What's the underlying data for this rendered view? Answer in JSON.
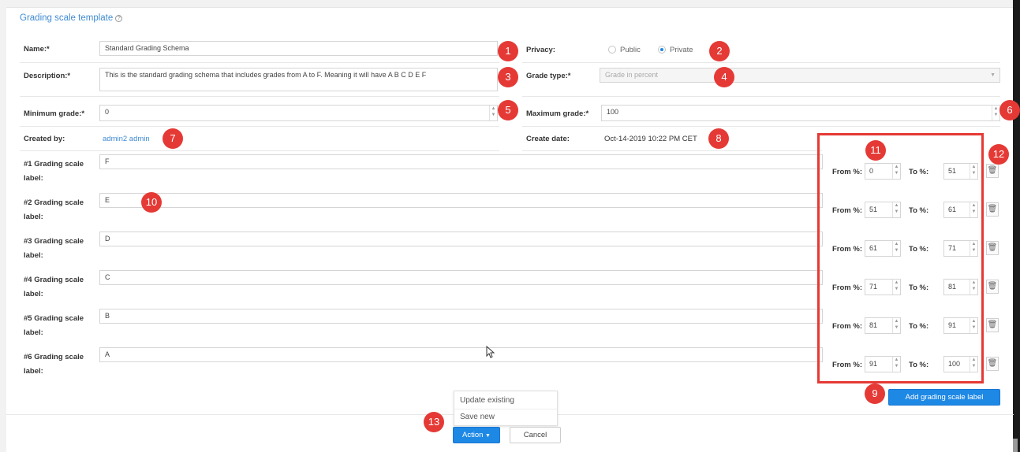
{
  "title": "Grading scale template",
  "help_icon": "question-circle-icon",
  "name": {
    "label": "Name:*",
    "value": "Standard Grading Schema"
  },
  "privacy": {
    "label": "Privacy:",
    "options": [
      "Public",
      "Private"
    ],
    "selected": "Private"
  },
  "description": {
    "label": "Description:*",
    "value": "This is the standard grading schema that includes grades from A to F. Meaning it will have A B C D E F"
  },
  "grade_type": {
    "label": "Grade type:*",
    "value": "Grade in percent"
  },
  "min_grade": {
    "label": "Minimum grade:*",
    "value": "0"
  },
  "max_grade": {
    "label": "Maximum grade:*",
    "value": "100"
  },
  "created_by": {
    "label": "Created by:",
    "value": "admin2 admin"
  },
  "create_date": {
    "label": "Create date:",
    "value": "Oct-14-2019 10:22 PM CET"
  },
  "scale_labels": [
    {
      "label": "#1 Grading scale label:",
      "value": "F",
      "from": "0",
      "to": "51"
    },
    {
      "label": "#2 Grading scale label:",
      "value": "E",
      "from": "51",
      "to": "61"
    },
    {
      "label": "#3 Grading scale label:",
      "value": "D",
      "from": "61",
      "to": "71"
    },
    {
      "label": "#4 Grading scale label:",
      "value": "C",
      "from": "71",
      "to": "81"
    },
    {
      "label": "#5 Grading scale label:",
      "value": "B",
      "from": "81",
      "to": "91"
    },
    {
      "label": "#6 Grading scale label:",
      "value": "A",
      "from": "91",
      "to": "100"
    }
  ],
  "range_labels": {
    "from": "From %:",
    "to": "To %:"
  },
  "add_button": "Add grading scale label",
  "action_menu": {
    "items": [
      "Update existing",
      "Save new"
    ]
  },
  "action_button": "Action",
  "cancel_button": "Cancel",
  "badges": [
    "1",
    "2",
    "3",
    "4",
    "5",
    "6",
    "7",
    "8",
    "9",
    "10",
    "11",
    "12",
    "13"
  ],
  "colors": {
    "accent": "#1e88e5",
    "link": "#3f8bd3",
    "annotation": "#e53935"
  }
}
